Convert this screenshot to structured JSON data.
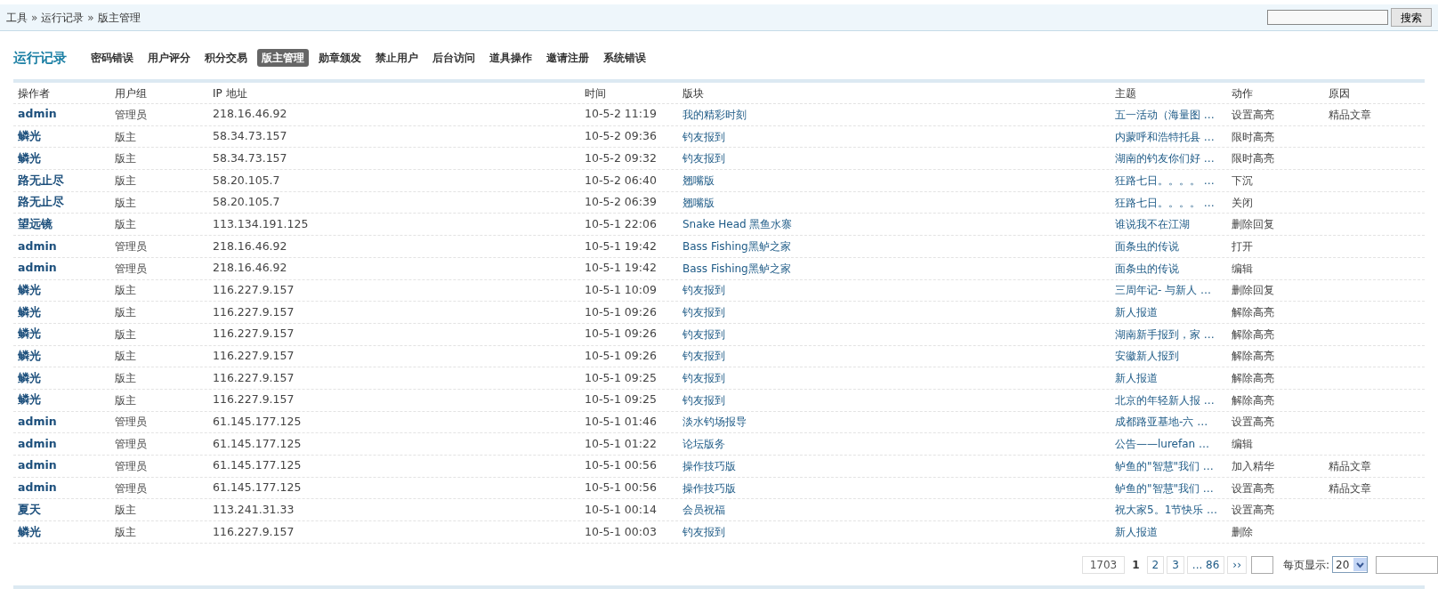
{
  "breadcrumb": [
    "工具",
    "运行记录",
    "版主管理"
  ],
  "breadcrumb_separator": "»",
  "search": {
    "button": "搜索"
  },
  "section_title": "运行记录",
  "tabs": [
    {
      "label": "密码错误",
      "selected": false
    },
    {
      "label": "用户评分",
      "selected": false
    },
    {
      "label": "积分交易",
      "selected": false
    },
    {
      "label": "版主管理",
      "selected": true
    },
    {
      "label": "勋章颁发",
      "selected": false
    },
    {
      "label": "禁止用户",
      "selected": false
    },
    {
      "label": "后台访问",
      "selected": false
    },
    {
      "label": "道具操作",
      "selected": false
    },
    {
      "label": "邀请注册",
      "selected": false
    },
    {
      "label": "系统错误",
      "selected": false
    }
  ],
  "table": {
    "columns": [
      "操作者",
      "用户组",
      "IP 地址",
      "时间",
      "版块",
      "主题",
      "动作",
      "原因"
    ],
    "rows": [
      [
        "admin",
        "管理员",
        "218.16.46.92",
        "10-5-2 11:19",
        "我的精彩时刻",
        "五一活动（海量图 …",
        "设置高亮",
        "精品文章"
      ],
      [
        "鳞光",
        "版主",
        "58.34.73.157",
        "10-5-2 09:36",
        "钓友报到",
        "内蒙呼和浩特托县 …",
        "限时高亮",
        ""
      ],
      [
        "鳞光",
        "版主",
        "58.34.73.157",
        "10-5-2 09:32",
        "钓友报到",
        "湖南的钓友你们好 …",
        "限时高亮",
        ""
      ],
      [
        "路无止尽",
        "版主",
        "58.20.105.7",
        "10-5-2 06:40",
        "翘嘴版",
        "狂路七日。。。。 …",
        "下沉",
        ""
      ],
      [
        "路无止尽",
        "版主",
        "58.20.105.7",
        "10-5-2 06:39",
        "翘嘴版",
        "狂路七日。。。。 …",
        "关闭",
        ""
      ],
      [
        "望远镜",
        "版主",
        "113.134.191.125",
        "10-5-1 22:06",
        "Snake Head 黑鱼水寨",
        "谁说我不在江湖",
        "删除回复",
        ""
      ],
      [
        "admin",
        "管理员",
        "218.16.46.92",
        "10-5-1 19:42",
        "Bass Fishing黑鲈之家",
        "面条虫的传说",
        "打开",
        ""
      ],
      [
        "admin",
        "管理员",
        "218.16.46.92",
        "10-5-1 19:42",
        "Bass Fishing黑鲈之家",
        "面条虫的传说",
        "编辑",
        ""
      ],
      [
        "鳞光",
        "版主",
        "116.227.9.157",
        "10-5-1 10:09",
        "钓友报到",
        "三周年记- 与新人 …",
        "删除回复",
        ""
      ],
      [
        "鳞光",
        "版主",
        "116.227.9.157",
        "10-5-1 09:26",
        "钓友报到",
        "新人报道",
        "解除高亮",
        ""
      ],
      [
        "鳞光",
        "版主",
        "116.227.9.157",
        "10-5-1 09:26",
        "钓友报到",
        "湖南新手报到，家 …",
        "解除高亮",
        ""
      ],
      [
        "鳞光",
        "版主",
        "116.227.9.157",
        "10-5-1 09:26",
        "钓友报到",
        "安徽新人报到",
        "解除高亮",
        ""
      ],
      [
        "鳞光",
        "版主",
        "116.227.9.157",
        "10-5-1 09:25",
        "钓友报到",
        "新人报道",
        "解除高亮",
        ""
      ],
      [
        "鳞光",
        "版主",
        "116.227.9.157",
        "10-5-1 09:25",
        "钓友报到",
        "北京的年轻新人报 …",
        "解除高亮",
        ""
      ],
      [
        "admin",
        "管理员",
        "61.145.177.125",
        "10-5-1 01:46",
        "淡水钓场报导",
        "成都路亚基地-六 …",
        "设置高亮",
        ""
      ],
      [
        "admin",
        "管理员",
        "61.145.177.125",
        "10-5-1 01:22",
        "论坛版务",
        "公告——lurefan …",
        "编辑",
        ""
      ],
      [
        "admin",
        "管理员",
        "61.145.177.125",
        "10-5-1 00:56",
        "操作技巧版",
        "鲈鱼的\"智慧\"我们 …",
        "加入精华",
        "精品文章"
      ],
      [
        "admin",
        "管理员",
        "61.145.177.125",
        "10-5-1 00:56",
        "操作技巧版",
        "鲈鱼的\"智慧\"我们 …",
        "设置高亮",
        "精品文章"
      ],
      [
        "夏天",
        "版主",
        "113.241.31.33",
        "10-5-1 00:14",
        "会员祝福",
        "祝大家5。1节快乐 …",
        "设置高亮",
        ""
      ],
      [
        "鳞光",
        "版主",
        "116.227.9.157",
        "10-5-1 00:03",
        "钓友报到",
        "新人报道",
        "删除",
        ""
      ]
    ]
  },
  "pagination": {
    "total": "1703",
    "pages": [
      {
        "label": "1",
        "selected": true
      },
      {
        "label": "2",
        "selected": false
      },
      {
        "label": "3",
        "selected": false
      },
      {
        "label": "... 86",
        "selected": false
      }
    ],
    "next": "››",
    "per_page_label": "每页显示:",
    "per_page": "20"
  }
}
